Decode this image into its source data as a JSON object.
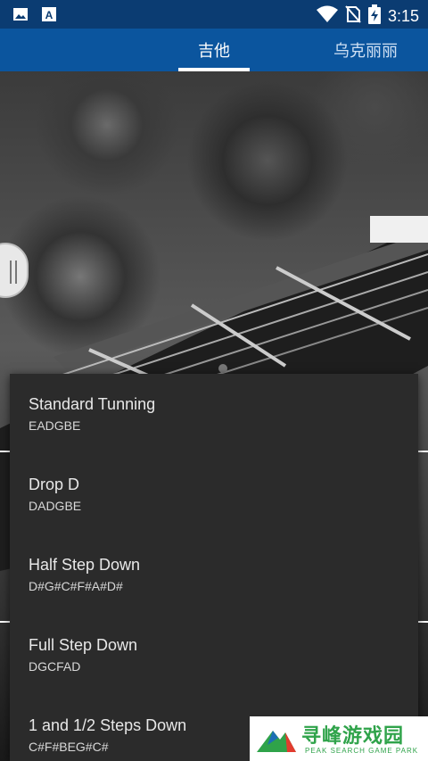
{
  "status_bar": {
    "time": "3:15",
    "icons": [
      "image-icon",
      "text-icon",
      "wifi-icon",
      "no-sim-icon",
      "battery-charging-icon"
    ]
  },
  "tabs": [
    {
      "label": "吉他",
      "active": true
    },
    {
      "label": "乌克丽丽",
      "active": false
    }
  ],
  "tunings": [
    {
      "name": "Standard Tunning",
      "notes": "EADGBE"
    },
    {
      "name": "Drop D",
      "notes": "DADGBE"
    },
    {
      "name": "Half Step Down",
      "notes": "D#G#C#F#A#D#"
    },
    {
      "name": "Full Step Down",
      "notes": "DGCFAD"
    },
    {
      "name": "1 and 1/2 Steps Down",
      "notes": "C#F#BEG#C#"
    }
  ],
  "watermark": {
    "title": "寻峰游戏园",
    "subtitle": "PEAK SEARCH GAME PARK"
  },
  "colors": {
    "status_bar": "#0b3c72",
    "tab_bar": "#0b559e",
    "dropdown_bg": "#2b2b2b",
    "watermark_green": "#2fa34a"
  }
}
